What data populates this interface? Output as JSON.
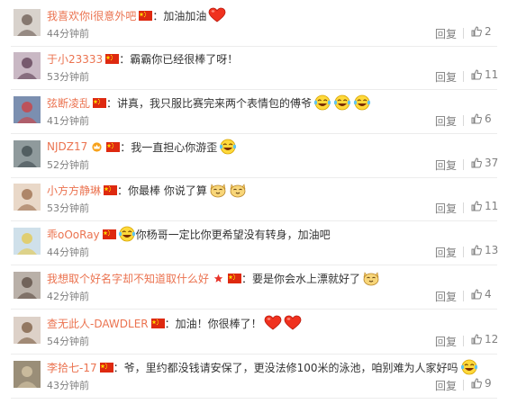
{
  "reply_label": "回复",
  "comments": [
    {
      "user": "我喜欢你i很意外吧",
      "badge": "",
      "text": "：加油加油",
      "emoji": [
        "heart"
      ],
      "time": "44分钟前",
      "likes": "2"
    },
    {
      "user": "于小23333",
      "badge": "",
      "text": "：霸霸你已经很棒了呀！",
      "emoji": [],
      "time": "53分钟前",
      "likes": "11"
    },
    {
      "user": "弦断凌乱",
      "badge": "",
      "text": "：讲真，我只服比赛完来两个表情包的傅爷",
      "emoji": [
        "laugh",
        "laugh",
        "laugh"
      ],
      "time": "41分钟前",
      "likes": "6"
    },
    {
      "user": "NJDZ17",
      "badge": "crown",
      "text": "：我一直担心你游歪",
      "emoji": [
        "laugh"
      ],
      "time": "52分钟前",
      "likes": "37"
    },
    {
      "user": "小方方静琳",
      "badge": "",
      "text": "：你最棒 你说了算",
      "emoji": [
        "cat",
        "cat"
      ],
      "time": "53分钟前",
      "likes": "11"
    },
    {
      "user": "乖oOoRay",
      "badge": "",
      "text": "你杨哥一定比你更希望没有转身，加油吧",
      "emoji_before": [
        "laugh"
      ],
      "emoji": [],
      "time": "44分钟前",
      "likes": "13"
    },
    {
      "user": "我想取个好名字却不知道取什么好",
      "badge": "star",
      "text": "：要是你会水上漂就好了",
      "emoji": [
        "cat"
      ],
      "time": "42分钟前",
      "likes": "4"
    },
    {
      "user": "查无此人-DAWDLER",
      "badge": "",
      "text": "：加油！你很棒了！",
      "emoji": [
        "heart",
        "heart"
      ],
      "time": "54分钟前",
      "likes": "12"
    },
    {
      "user": "李拾七-17",
      "badge": "",
      "text": "：爷，里约都没钱请安保了，更没法修100米的泳池，咱别难为人家好吗",
      "emoji": [
        "laugh"
      ],
      "time": "43分钟前",
      "likes": "9"
    }
  ],
  "colors": {
    "username": "#eb7350",
    "text": "#333333",
    "meta": "#808080"
  }
}
